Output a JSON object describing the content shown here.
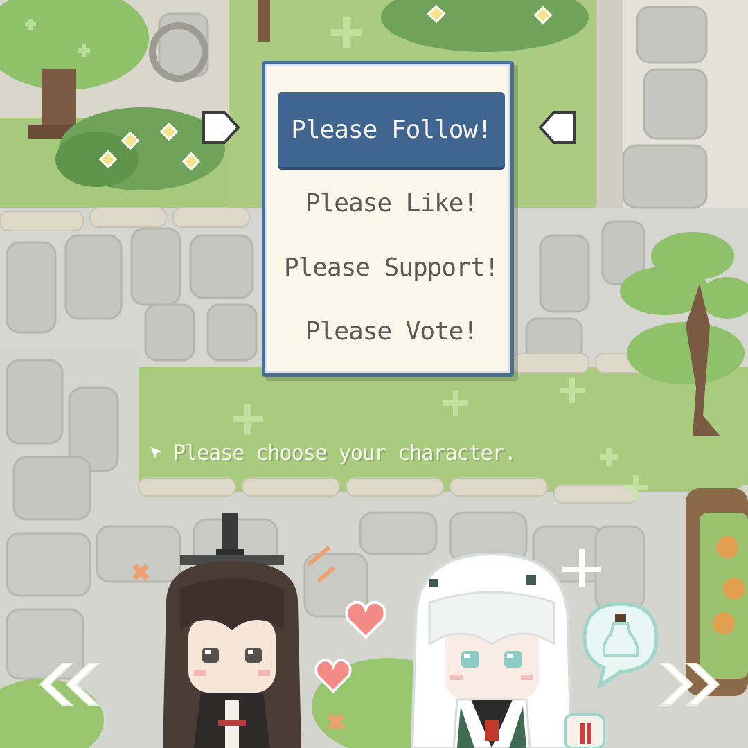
{
  "menu": {
    "items": [
      {
        "label": "Please Follow!",
        "selected": true
      },
      {
        "label": "Please Like!",
        "selected": false
      },
      {
        "label": "Please Support!",
        "selected": false
      },
      {
        "label": "Please Vote!",
        "selected": false
      }
    ]
  },
  "prompt": {
    "text": "Please choose your character."
  },
  "icons": {
    "selector_left": "arrow-right-icon",
    "selector_right": "arrow-left-icon",
    "prev": "double-chevron-left-icon",
    "next": "double-chevron-right-icon",
    "prompt_bullet": "star-icon",
    "heart": "heart-icon",
    "bottle_bubble": "bottle-speech-bubble-icon"
  },
  "colors": {
    "menu_accent": "#3f6590",
    "menu_bg": "#fbf6ea",
    "grass": "#a7c97c",
    "stone": "#d6d8d2"
  }
}
